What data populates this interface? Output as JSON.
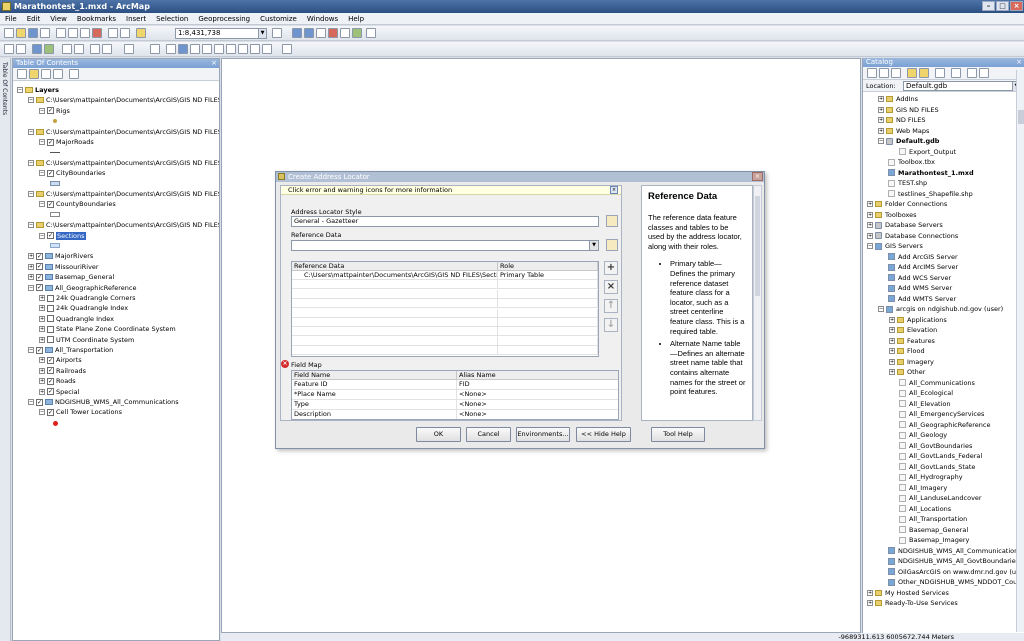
{
  "window": {
    "title": "Marathontest_1.mxd - ArcMap"
  },
  "menu": [
    "File",
    "Edit",
    "View",
    "Bookmarks",
    "Insert",
    "Selection",
    "Geoprocessing",
    "Customize",
    "Windows",
    "Help"
  ],
  "toolbar": {
    "scale": "1:8,431,738"
  },
  "toc": {
    "title": "Table Of Contents",
    "side_tab": "Table Of Contents",
    "rows": [
      {
        "label": "Layers",
        "bold": true,
        "indent": 0,
        "pm": "−",
        "cb": false,
        "icon": "layers"
      },
      {
        "label": "C:\\Users\\mattpainter\\Documents\\ArcGIS\\GIS ND FILES\\",
        "indent": 1,
        "pm": "−",
        "cb": false,
        "icon": "folder"
      },
      {
        "label": "Rigs",
        "indent": 2,
        "pm": "−",
        "cb": true
      },
      {
        "label": "",
        "indent": 3,
        "sym": "dot-orange"
      },
      {
        "label": "C:\\Users\\mattpainter\\Documents\\ArcGIS\\GIS ND FILES\\",
        "indent": 1,
        "pm": "−",
        "cb": false,
        "icon": "folder"
      },
      {
        "label": "MajorRoads",
        "indent": 2,
        "pm": "−",
        "cb": true
      },
      {
        "label": "",
        "indent": 3,
        "sym": "line"
      },
      {
        "label": "C:\\Users\\mattpainter\\Documents\\ArcGIS\\GIS ND FILES\\",
        "indent": 1,
        "pm": "−",
        "cb": false,
        "icon": "folder"
      },
      {
        "label": "CityBoundaries",
        "indent": 2,
        "pm": "−",
        "cb": true
      },
      {
        "label": "",
        "indent": 3,
        "sym": "box-blue"
      },
      {
        "label": "C:\\Users\\mattpainter\\Documents\\ArcGIS\\GIS ND FILES\\",
        "indent": 1,
        "pm": "−",
        "cb": false,
        "icon": "folder"
      },
      {
        "label": "CountyBoundaries",
        "indent": 2,
        "pm": "−",
        "cb": true
      },
      {
        "label": "",
        "indent": 3,
        "sym": "box-white"
      },
      {
        "label": "C:\\Users\\mattpainter\\Documents\\ArcGIS\\GIS ND FILES\\",
        "indent": 1,
        "pm": "−",
        "cb": false,
        "icon": "folder"
      },
      {
        "label": "Sections",
        "indent": 2,
        "pm": "−",
        "cb": true,
        "selected": true
      },
      {
        "label": "",
        "indent": 3,
        "sym": "box-lightblue"
      },
      {
        "label": "MajorRivers",
        "indent": 1,
        "pm": "+",
        "cb": true,
        "icon": "service"
      },
      {
        "label": "MissouriRiver",
        "indent": 1,
        "pm": "+",
        "cb": true,
        "icon": "service"
      },
      {
        "label": "Basemap_General",
        "indent": 1,
        "pm": "+",
        "cb": true,
        "icon": "service"
      },
      {
        "label": "All_GeographicReference",
        "indent": 1,
        "pm": "−",
        "cb": true,
        "icon": "service"
      },
      {
        "label": "24k Quadrangle Corners",
        "indent": 2,
        "pm": "+",
        "cb": false
      },
      {
        "label": "24k Quadrangle Index",
        "indent": 2,
        "pm": "+",
        "cb": false
      },
      {
        "label": "Quadrangle Index",
        "indent": 2,
        "pm": "+",
        "cb": false
      },
      {
        "label": "State Plane Zone Coordinate System",
        "indent": 2,
        "pm": "+",
        "cb": false
      },
      {
        "label": "UTM Coordinate System",
        "indent": 2,
        "pm": "+",
        "cb": false
      },
      {
        "label": "All_Transportation",
        "indent": 1,
        "pm": "−",
        "cb": true,
        "icon": "service"
      },
      {
        "label": "Airports",
        "indent": 2,
        "pm": "+",
        "cb": true
      },
      {
        "label": "Railroads",
        "indent": 2,
        "pm": "+",
        "cb": true
      },
      {
        "label": "Roads",
        "indent": 2,
        "pm": "+",
        "cb": true
      },
      {
        "label": "Special",
        "indent": 2,
        "pm": "+",
        "cb": true
      },
      {
        "label": "NDGISHUB_WMS_All_Communications",
        "indent": 1,
        "pm": "−",
        "cb": true,
        "icon": "service"
      },
      {
        "label": "Cell Tower Locations",
        "indent": 2,
        "pm": "−",
        "cb": true
      },
      {
        "label": "",
        "indent": 3,
        "sym": "dot-red"
      }
    ]
  },
  "catalog": {
    "title": "Catalog",
    "location_label": "Location:",
    "location_value": "Default.gdb",
    "rows": [
      {
        "label": "AddIns",
        "indent": 1,
        "pm": "+",
        "icon": "f"
      },
      {
        "label": "GIS ND FILES",
        "indent": 1,
        "pm": "+",
        "icon": "f"
      },
      {
        "label": "ND FILES",
        "indent": 1,
        "pm": "+",
        "icon": "f"
      },
      {
        "label": "Web Maps",
        "indent": 1,
        "pm": "+",
        "icon": "f"
      },
      {
        "label": "Default.gdb",
        "indent": 1,
        "pm": "−",
        "icon": "db",
        "bold": true
      },
      {
        "label": "Export_Output",
        "indent": 2,
        "icon": "l"
      },
      {
        "label": "Toolbox.tbx",
        "indent": 1,
        "icon": "l"
      },
      {
        "label": "Marathontest_1.mxd",
        "indent": 1,
        "icon": "s",
        "bold": true
      },
      {
        "label": "TEST.shp",
        "indent": 1,
        "icon": "l"
      },
      {
        "label": "testlines_Shapefile.shp",
        "indent": 1,
        "icon": "l"
      },
      {
        "label": "Folder Connections",
        "indent": 0,
        "pm": "+",
        "icon": "f"
      },
      {
        "label": "Toolboxes",
        "indent": 0,
        "pm": "+",
        "icon": "f"
      },
      {
        "label": "Database Servers",
        "indent": 0,
        "pm": "+",
        "icon": "db"
      },
      {
        "label": "Database Connections",
        "indent": 0,
        "pm": "+",
        "icon": "db"
      },
      {
        "label": "GIS Servers",
        "indent": 0,
        "pm": "−",
        "icon": "s"
      },
      {
        "label": "Add ArcGIS Server",
        "indent": 1,
        "icon": "s"
      },
      {
        "label": "Add ArcIMS Server",
        "indent": 1,
        "icon": "s"
      },
      {
        "label": "Add WCS Server",
        "indent": 1,
        "icon": "s"
      },
      {
        "label": "Add WMS Server",
        "indent": 1,
        "icon": "s"
      },
      {
        "label": "Add WMTS Server",
        "indent": 1,
        "icon": "s"
      },
      {
        "label": "arcgis on ndgishub.nd.gov (user)",
        "indent": 1,
        "pm": "−",
        "icon": "s"
      },
      {
        "label": "Applications",
        "indent": 2,
        "pm": "+",
        "icon": "f"
      },
      {
        "label": "Elevation",
        "indent": 2,
        "pm": "+",
        "icon": "f"
      },
      {
        "label": "Features",
        "indent": 2,
        "pm": "+",
        "icon": "f"
      },
      {
        "label": "Flood",
        "indent": 2,
        "pm": "+",
        "icon": "f"
      },
      {
        "label": "Imagery",
        "indent": 2,
        "pm": "+",
        "icon": "f"
      },
      {
        "label": "Other",
        "indent": 2,
        "pm": "+",
        "icon": "f"
      },
      {
        "label": "All_Communications",
        "indent": 2,
        "icon": "l"
      },
      {
        "label": "All_Ecological",
        "indent": 2,
        "icon": "l"
      },
      {
        "label": "All_Elevation",
        "indent": 2,
        "icon": "l"
      },
      {
        "label": "All_EmergencyServices",
        "indent": 2,
        "icon": "l"
      },
      {
        "label": "All_GeographicReference",
        "indent": 2,
        "icon": "l"
      },
      {
        "label": "All_Geology",
        "indent": 2,
        "icon": "l"
      },
      {
        "label": "All_GovtBoundaries",
        "indent": 2,
        "icon": "l"
      },
      {
        "label": "All_GovtLands_Federal",
        "indent": 2,
        "icon": "l"
      },
      {
        "label": "All_GovtLands_State",
        "indent": 2,
        "icon": "l"
      },
      {
        "label": "All_Hydrography",
        "indent": 2,
        "icon": "l"
      },
      {
        "label": "All_Imagery",
        "indent": 2,
        "icon": "l"
      },
      {
        "label": "All_LanduseLandcover",
        "indent": 2,
        "icon": "l"
      },
      {
        "label": "All_Locations",
        "indent": 2,
        "icon": "l"
      },
      {
        "label": "All_Transportation",
        "indent": 2,
        "icon": "l"
      },
      {
        "label": "Basemap_General",
        "indent": 2,
        "icon": "l"
      },
      {
        "label": "Basemap_Imagery",
        "indent": 2,
        "icon": "l"
      },
      {
        "label": "NDGISHUB_WMS_All_Communications",
        "indent": 1,
        "icon": "s"
      },
      {
        "label": "NDGISHUB_WMS_All_GovtBoundaries",
        "indent": 1,
        "icon": "s"
      },
      {
        "label": "OilGasArcGIS on www.dmr.nd.gov (use",
        "indent": 1,
        "icon": "s"
      },
      {
        "label": "Other_NDGISHUB_WMS_NDDOT_Cour",
        "indent": 1,
        "icon": "s"
      },
      {
        "label": "My Hosted Services",
        "indent": 0,
        "pm": "+",
        "icon": "f"
      },
      {
        "label": "Ready-To-Use Services",
        "indent": 0,
        "pm": "+",
        "icon": "f"
      }
    ]
  },
  "status": {
    "coords": "-9689311.613  6005672.744 Meters"
  },
  "dialog": {
    "title": "Create Address Locator",
    "info": "Click error and warning icons for more information",
    "style_label": "Address Locator Style",
    "style_value": "General - Gazetteer",
    "refdata_label": "Reference Data",
    "refdata_value": "",
    "ref_table": {
      "headers": [
        "Reference Data",
        "Role"
      ],
      "rows": [
        [
          "C:\\Users\\mattpainter\\Documents\\ArcGIS\\GIS ND FILES\\Sectio...",
          "Primary Table"
        ]
      ]
    },
    "fieldmap_label": "Field Map",
    "field_table": {
      "headers": [
        "Field Name",
        "Alias Name"
      ],
      "rows": [
        [
          "Feature ID",
          "FID"
        ],
        [
          "*Place Name",
          "<None>"
        ],
        [
          "Type",
          "<None>"
        ],
        [
          "Description",
          "<None>"
        ]
      ]
    },
    "buttons": {
      "ok": "OK",
      "cancel": "Cancel",
      "env": "Environments...",
      "hide": "<< Hide Help",
      "toolhelp": "Tool Help"
    },
    "help": {
      "heading": "Reference Data",
      "intro": "The reference data feature classes and tables to be used by the address locator, along with their roles.",
      "bullets": [
        "Primary table—Defines the primary reference dataset feature class for a locator, such as a street centerline feature class. This is a required table.",
        "Alternate Name table—Defines an alternate street name table that contains alternate names for the street or point features."
      ]
    }
  }
}
